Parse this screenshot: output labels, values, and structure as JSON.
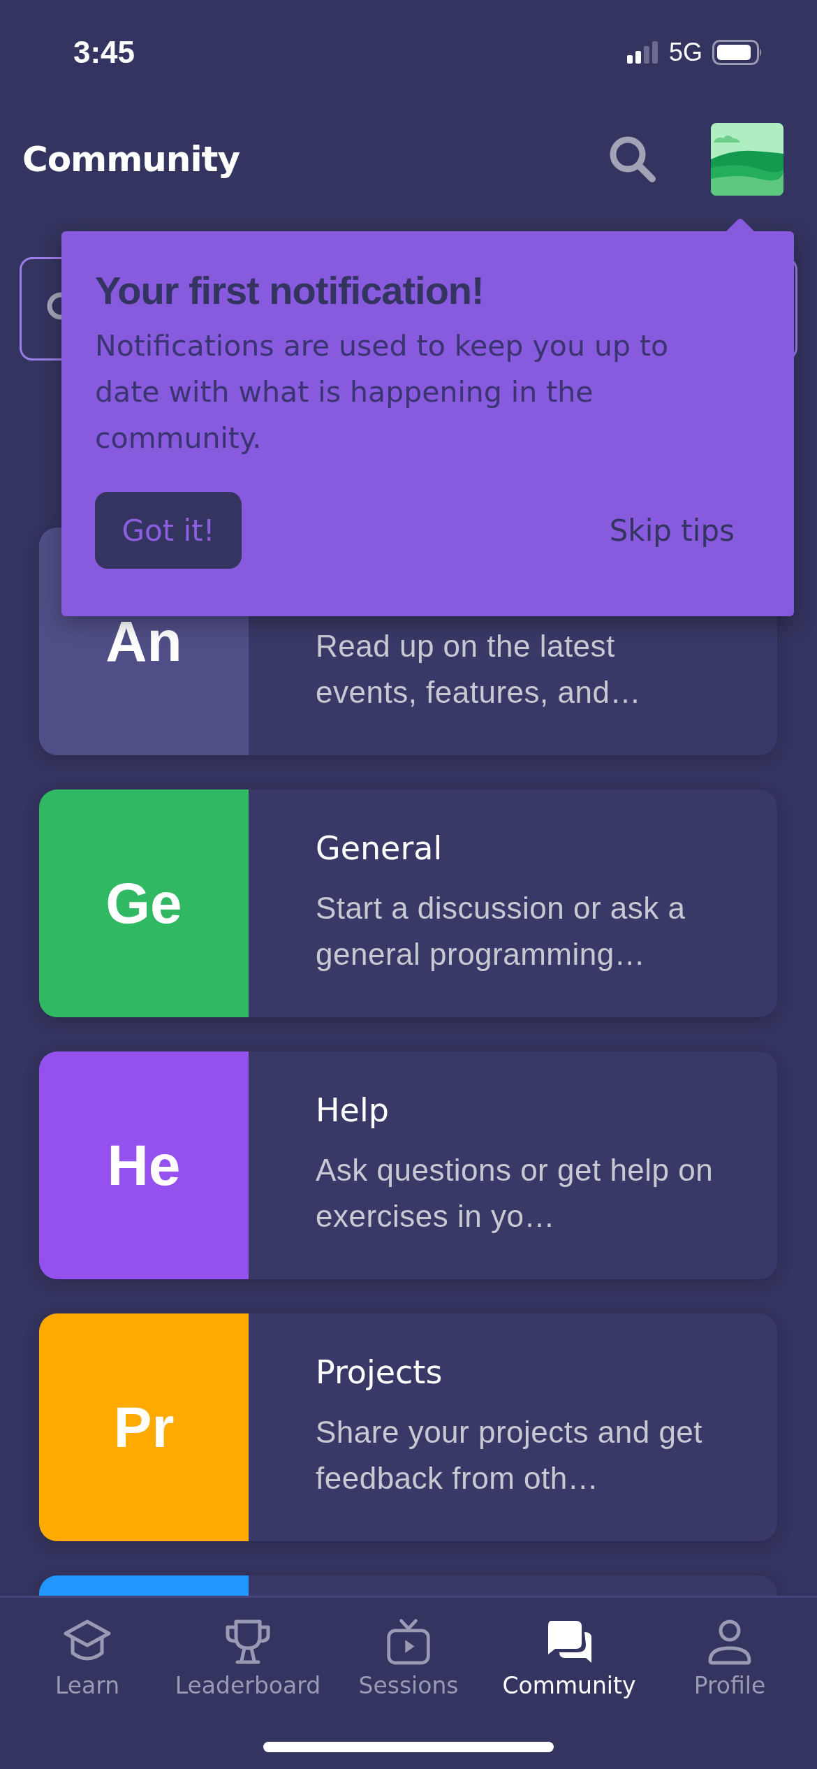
{
  "status_bar": {
    "time": "3:45",
    "network": "5G"
  },
  "header": {
    "title": "Community"
  },
  "tooltip": {
    "title": "Your first notification!",
    "body": "Notifications are used to keep you up to date with what is happening in the community.",
    "primary_button": "Got it!",
    "secondary_button": "Skip tips"
  },
  "forums": [
    {
      "abbr": "An",
      "color": "#4f4e86",
      "description": "Read up on the latest events, features, and…"
    },
    {
      "abbr": "Ge",
      "title": "General",
      "color": "#31b863",
      "description": "Start a discussion or ask a general programming…"
    },
    {
      "abbr": "He",
      "title": "Help",
      "color": "#9451ee",
      "description": "Ask questions or get help on exercises in yo…"
    },
    {
      "abbr": "Pr",
      "title": "Projects",
      "color": "#ffaa00",
      "description": "Share your projects and get feedback from oth…"
    },
    {
      "color": "#2196ff"
    }
  ],
  "tab_bar": [
    {
      "kind": "learn",
      "label": "Learn",
      "selected": false
    },
    {
      "kind": "leaderboard",
      "label": "Leaderboard",
      "selected": false
    },
    {
      "kind": "sessions",
      "label": "Sessions",
      "selected": false
    },
    {
      "kind": "community",
      "label": "Community",
      "selected": true
    },
    {
      "kind": "profile",
      "label": "Profile",
      "selected": false
    }
  ]
}
